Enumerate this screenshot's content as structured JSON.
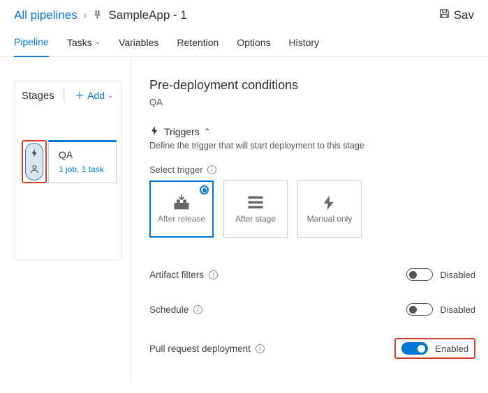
{
  "breadcrumb": {
    "root": "All pipelines",
    "current": "SampleApp - 1"
  },
  "header": {
    "save": "Sav"
  },
  "tabs": {
    "pipeline": "Pipeline",
    "tasks": "Tasks",
    "variables": "Variables",
    "retention": "Retention",
    "options": "Options",
    "history": "History"
  },
  "stagesPanel": {
    "title": "Stages",
    "add": "Add",
    "stage": {
      "name": "QA",
      "sub": "1 job, 1 task"
    }
  },
  "predeploy": {
    "title": "Pre-deployment conditions",
    "stage": "QA",
    "triggers": {
      "header": "Triggers",
      "desc": "Define the trigger that will start deployment to this stage",
      "selectLabel": "Select trigger",
      "opts": {
        "after_release": "After release",
        "after_stage": "After stage",
        "manual": "Manual only"
      }
    },
    "rows": {
      "artifact": {
        "label": "Artifact filters",
        "state": "Disabled"
      },
      "schedule": {
        "label": "Schedule",
        "state": "Disabled"
      },
      "pr": {
        "label": "Pull request deployment",
        "state": "Enabled"
      }
    }
  }
}
